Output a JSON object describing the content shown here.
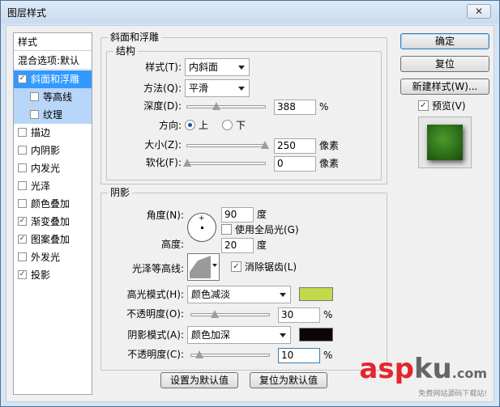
{
  "window": {
    "title": "图层样式",
    "close": "✕"
  },
  "style_list": {
    "header": "样式",
    "blend_default": "混合选项:默认",
    "items": [
      {
        "label": "斜面和浮雕",
        "checked": true
      },
      {
        "label": "等高线",
        "checked": false
      },
      {
        "label": "纹理",
        "checked": false
      },
      {
        "label": "描边",
        "checked": false
      },
      {
        "label": "内阴影",
        "checked": false
      },
      {
        "label": "内发光",
        "checked": false
      },
      {
        "label": "光泽",
        "checked": false
      },
      {
        "label": "颜色叠加",
        "checked": false
      },
      {
        "label": "渐变叠加",
        "checked": true
      },
      {
        "label": "图案叠加",
        "checked": true
      },
      {
        "label": "外发光",
        "checked": false
      },
      {
        "label": "投影",
        "checked": true
      }
    ]
  },
  "bevel": {
    "title": "斜面和浮雕",
    "structure_title": "结构",
    "style_label": "样式(T):",
    "style_value": "内斜面",
    "technique_label": "方法(Q):",
    "technique_value": "平滑",
    "depth_label": "深度(D):",
    "depth_value": "388",
    "depth_unit": "%",
    "depth_fraction": 0.38,
    "direction_label": "方向:",
    "direction_up": "上",
    "direction_down": "下",
    "size_label": "大小(Z):",
    "size_value": "250",
    "size_unit": "像素",
    "size_fraction": 1.0,
    "soften_label": "软化(F):",
    "soften_value": "0",
    "soften_unit": "像素",
    "soften_fraction": 0.0
  },
  "shading": {
    "title": "阴影",
    "angle_label": "角度(N):",
    "angle_value": "90",
    "angle_unit": "度",
    "global_light_label": "使用全局光(G)",
    "altitude_label": "高度:",
    "altitude_value": "20",
    "altitude_unit": "度",
    "gloss_label": "光泽等高线:",
    "antialias_label": "消除锯齿(L)",
    "highlight_mode_label": "高光模式(H):",
    "highlight_mode_value": "颜色减淡",
    "highlight_color": "#c3d84a",
    "highlight_opacity_label": "不透明度(O):",
    "highlight_opacity_value": "30",
    "highlight_opacity_unit": "%",
    "highlight_opacity_fraction": 0.3,
    "shadow_mode_label": "阴影模式(A):",
    "shadow_mode_value": "颜色加深",
    "shadow_color": "#0d0508",
    "shadow_opacity_label": "不透明度(C):",
    "shadow_opacity_value": "10",
    "shadow_opacity_unit": "%",
    "shadow_opacity_fraction": 0.1
  },
  "bottom_buttons": {
    "make_default": "设置为默认值",
    "reset_default": "复位为默认值"
  },
  "right_buttons": {
    "ok": "确定",
    "reset": "复位",
    "new_style": "新建样式(W)...",
    "preview": "预览(V)"
  },
  "watermark": {
    "logo_a": "asp",
    "logo_k": "ku",
    "logo_suffix": ".com",
    "sub": "免费网站源码下载站!"
  }
}
